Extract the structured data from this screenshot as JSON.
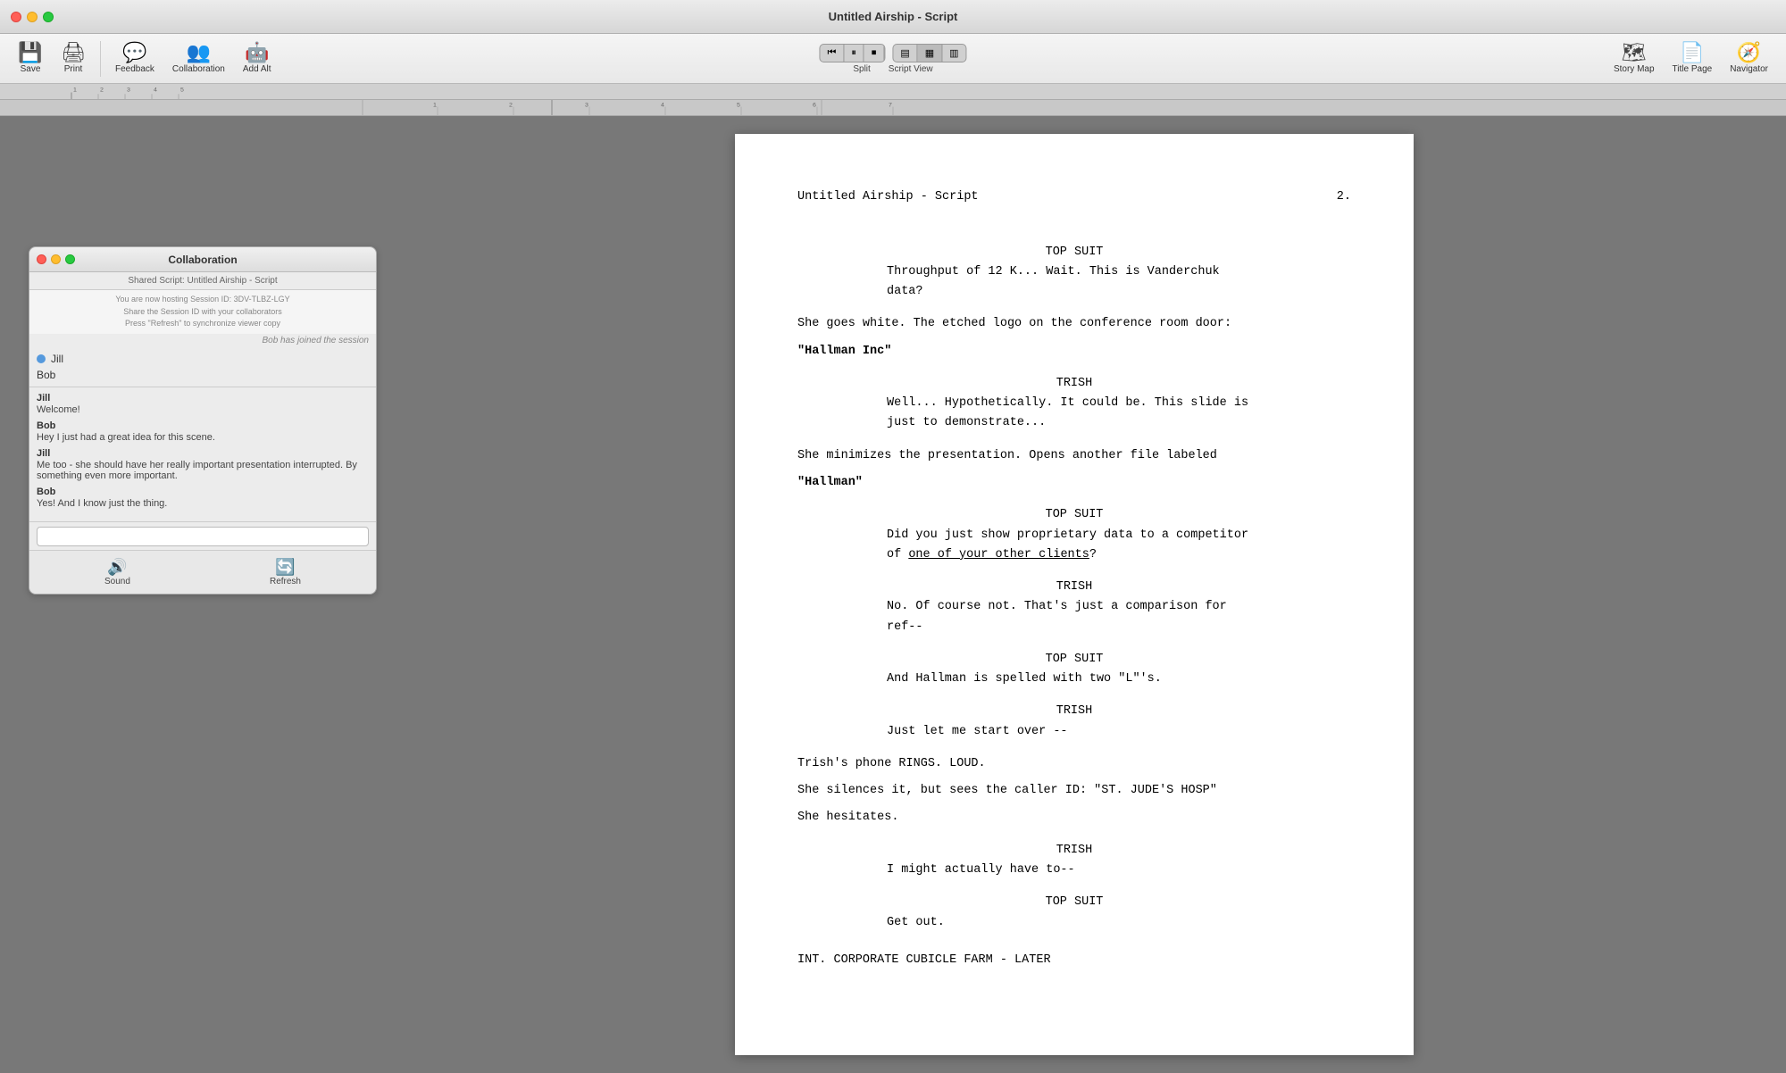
{
  "window": {
    "title": "Untitled Airship - Script"
  },
  "toolbar": {
    "save_label": "Save",
    "print_label": "Print",
    "feedback_label": "Feedback",
    "collaboration_label": "Collaboration",
    "addalt_label": "Add Alt",
    "split_label": "Split",
    "script_view_label": "Script View",
    "story_map_label": "Story Map",
    "title_page_label": "Title Page",
    "navigator_label": "Navigator"
  },
  "collaboration": {
    "title": "Collaboration",
    "shared_info": "Shared Script: Untitled Airship - Script",
    "session_notice": "You are now hosting Session ID: 3DV-TLBZ-LGY",
    "session_share": "Share the Session ID with your collaborators",
    "session_refresh": "Press \"Refresh\" to synchronize viewer copy",
    "session_joined": "Bob has joined the session",
    "session_id_label": "Session ID:",
    "session_id_value": "3DV-TLBZ-LGY",
    "users": [
      {
        "name": "Jill",
        "active": true
      },
      {
        "name": "Bob",
        "active": false
      }
    ],
    "messages": [
      {
        "sender": "Jill",
        "text": "Welcome!"
      },
      {
        "sender": "Bob",
        "text": "Hey I just had a great idea for this scene."
      },
      {
        "sender": "Jill",
        "text": "Me too - she should have her really important presentation interrupted. By something even more important."
      },
      {
        "sender": "Bob",
        "text": "Yes! And I know just the thing."
      }
    ],
    "sound_label": "Sound",
    "refresh_label": "Refresh"
  },
  "script": {
    "title": "Untitled Airship - Script",
    "page_number": "2.",
    "lines": [
      {
        "type": "character",
        "text": "TOP SUIT"
      },
      {
        "type": "dialogue",
        "text": "Throughput of 12 K... Wait. This is Vanderchuk data?"
      },
      {
        "type": "action",
        "text": "She goes white. The etched logo on the conference room door:"
      },
      {
        "type": "action_bold",
        "text": "\"Hallman Inc\""
      },
      {
        "type": "character",
        "text": "TRISH"
      },
      {
        "type": "dialogue",
        "text": "Well... Hypothetically. It could be. This slide is just to demonstrate..."
      },
      {
        "type": "action",
        "text": "She minimizes the presentation. Opens another file labeled"
      },
      {
        "type": "action_bold",
        "text": "\"Hallman\""
      },
      {
        "type": "character",
        "text": "TOP SUIT"
      },
      {
        "type": "dialogue",
        "text": "Did you just show proprietary data to a competitor of one of your other clients?"
      },
      {
        "type": "character",
        "text": "TRISH"
      },
      {
        "type": "dialogue",
        "text": "No. Of course not. That's just a comparison for ref--"
      },
      {
        "type": "character",
        "text": "TOP SUIT"
      },
      {
        "type": "dialogue",
        "text": "And Hallman is spelled with two \"L\"'s."
      },
      {
        "type": "character",
        "text": "TRISH"
      },
      {
        "type": "dialogue",
        "text": "Just let me start over --"
      },
      {
        "type": "action",
        "text": "Trish's phone RINGS. LOUD."
      },
      {
        "type": "action",
        "text": "She silences it, but sees the caller ID: \"ST. JUDE'S HOSP\""
      },
      {
        "type": "action",
        "text": "She hesitates."
      },
      {
        "type": "character",
        "text": "TRISH"
      },
      {
        "type": "dialogue",
        "text": "I might actually have to--"
      },
      {
        "type": "character",
        "text": "TOP SUIT"
      },
      {
        "type": "dialogue",
        "text": "Get out."
      },
      {
        "type": "scene",
        "text": "INT. CORPORATE CUBICLE FARM - LATER"
      }
    ]
  }
}
